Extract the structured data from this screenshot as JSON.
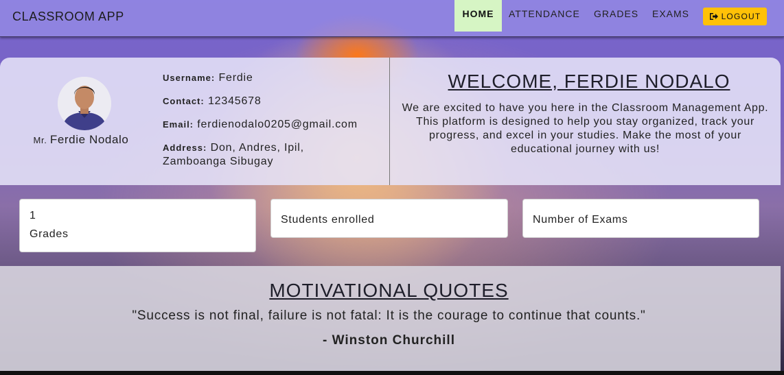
{
  "navbar": {
    "brand": "CLASSROOM APP",
    "links": [
      {
        "label": "HOME",
        "active": true
      },
      {
        "label": "ATTENDANCE"
      },
      {
        "label": "GRADES"
      },
      {
        "label": "EXAMS"
      }
    ],
    "logout_label": "LOGOUT",
    "logout_icon": "sign-out-icon",
    "accent_color": "#ffc107",
    "active_color": "#d6f5c4"
  },
  "profile": {
    "title": "Mr.",
    "name": "Ferdie Nodalo",
    "fields": [
      {
        "label": "Username:",
        "value": "Ferdie"
      },
      {
        "label": "Contact:",
        "value": "12345678"
      },
      {
        "label": "Email:",
        "value": "ferdienodalo0205@gmail.com"
      },
      {
        "label": "Address:",
        "value": "Don, Andres, Ipil, Zamboanga Sibugay"
      }
    ]
  },
  "welcome": {
    "title": "WELCOME, FERDIE NODALO",
    "text": "We are excited to have you here in the Classroom Management App. This platform is designed to help you stay organized, track your progress, and excel in your studies. Make the most of your educational journey with us!"
  },
  "stats": [
    {
      "value": "1",
      "label": "Grades"
    },
    {
      "value": "",
      "label": "Students enrolled"
    },
    {
      "value": "",
      "label": "Number of Exams"
    }
  ],
  "quotes": {
    "title": "MOTIVATIONAL QUOTES",
    "quote": "\"Success is not final, failure is not fatal: It is the courage to continue that counts.\"",
    "author": "- Winston Churchill"
  }
}
